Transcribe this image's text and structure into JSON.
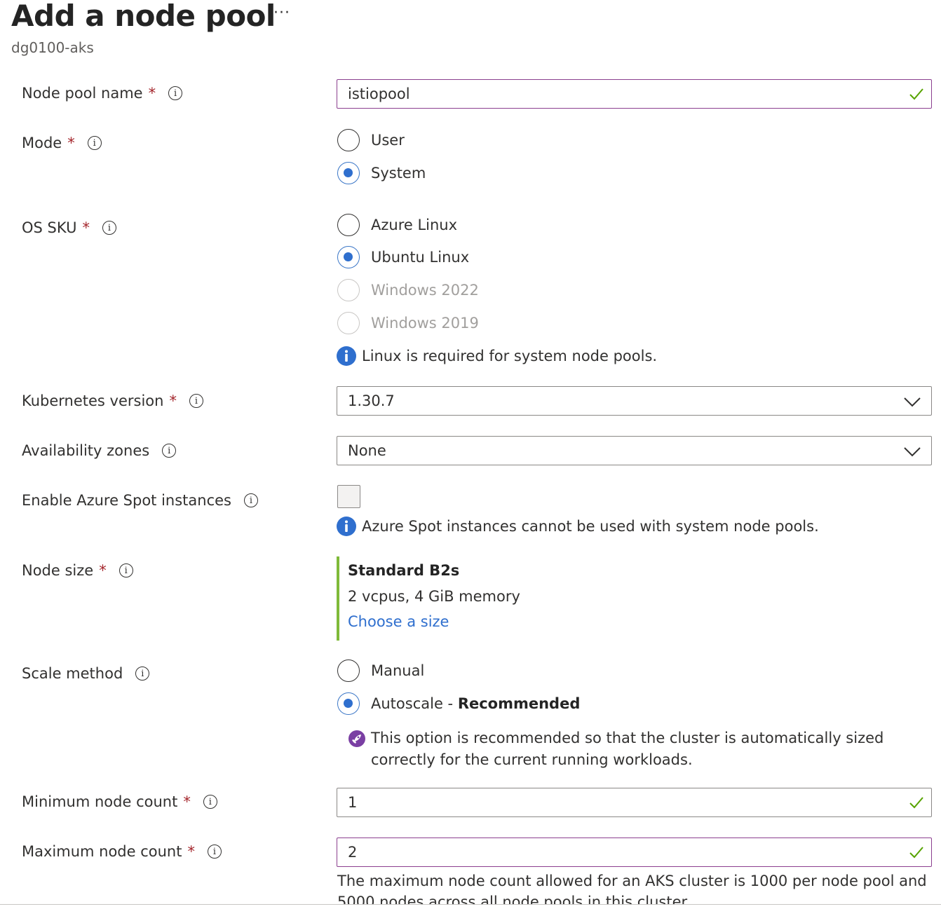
{
  "header": {
    "title": "Add a node pool",
    "more_label": "···",
    "subtitle": "dg0100-aks"
  },
  "fields": {
    "node_pool_name": {
      "label": "Node pool name",
      "value": "istiopool"
    },
    "mode": {
      "label": "Mode",
      "options": [
        "User",
        "System"
      ],
      "selected": "System"
    },
    "os_sku": {
      "label": "OS SKU",
      "options": [
        "Azure Linux",
        "Ubuntu Linux",
        "Windows 2022",
        "Windows 2019"
      ],
      "selected": "Ubuntu Linux",
      "disabled": [
        "Windows 2022",
        "Windows 2019"
      ],
      "note": "Linux is required for system node pools."
    },
    "kubernetes_version": {
      "label": "Kubernetes version",
      "value": "1.30.7"
    },
    "availability_zones": {
      "label": "Availability zones",
      "value": "None"
    },
    "spot": {
      "label": "Enable Azure Spot instances",
      "checked": false,
      "note": "Azure Spot instances cannot be used with system node pools."
    },
    "node_size": {
      "label": "Node size",
      "name": "Standard B2s",
      "spec": "2 vcpus, 4 GiB memory",
      "link": "Choose a size"
    },
    "scale_method": {
      "label": "Scale method",
      "options": [
        "Manual",
        "Autoscale"
      ],
      "selected": "Autoscale",
      "separator": " - ",
      "recommended": "Recommended",
      "note": "This option is recommended so that the cluster is automatically sized correctly for the current running workloads."
    },
    "min_node_count": {
      "label": "Minimum node count",
      "value": "1"
    },
    "max_node_count": {
      "label": "Maximum node count",
      "value": "2",
      "help": "The maximum node count allowed for an AKS cluster is 1000 per node pool and 5000 nodes across all node pools in this cluster."
    }
  },
  "required_marker": "*",
  "info_glyph": "i",
  "colors": {
    "accent": "#2f6fce",
    "required": "#a4262c",
    "valid": "#57a300",
    "focus_border": "#8b3f8f",
    "size_bar": "#7fba39"
  }
}
